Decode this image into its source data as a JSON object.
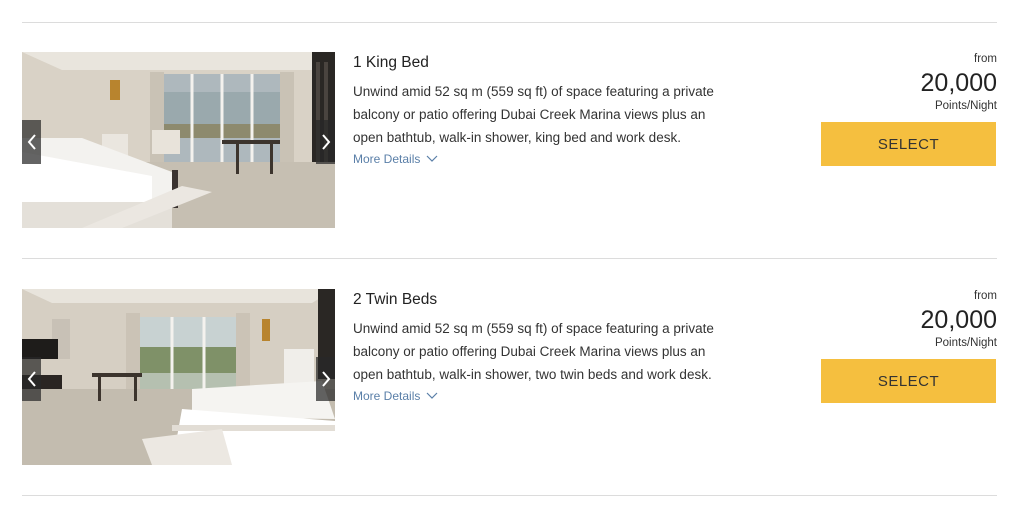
{
  "rooms": [
    {
      "title": "1 King Bed",
      "description": "Unwind amid 52 sq m (559 sq ft) of space featuring a private balcony or patio offering Dubai Creek Marina views plus an open bathtub, walk-in shower, king bed and work desk.",
      "more_details": "More Details",
      "from_label": "from",
      "points": "20,000",
      "per_night": "Points/Night",
      "select_label": "SELECT"
    },
    {
      "title": "2 Twin Beds",
      "description": "Unwind amid 52 sq m (559 sq ft) of space featuring a private balcony or patio offering Dubai Creek Marina views plus an open bathtub, walk-in shower, two twin beds and work desk.",
      "more_details": "More Details",
      "from_label": "from",
      "points": "20,000",
      "per_night": "Points/Night",
      "select_label": "SELECT"
    }
  ],
  "colors": {
    "accent_button": "#f5bf3f",
    "link": "#5a7fa8",
    "divider": "#dcdcdc"
  },
  "icons": {
    "prev": "chevron-left-icon",
    "next": "chevron-right-icon",
    "expand": "chevron-down-icon"
  }
}
